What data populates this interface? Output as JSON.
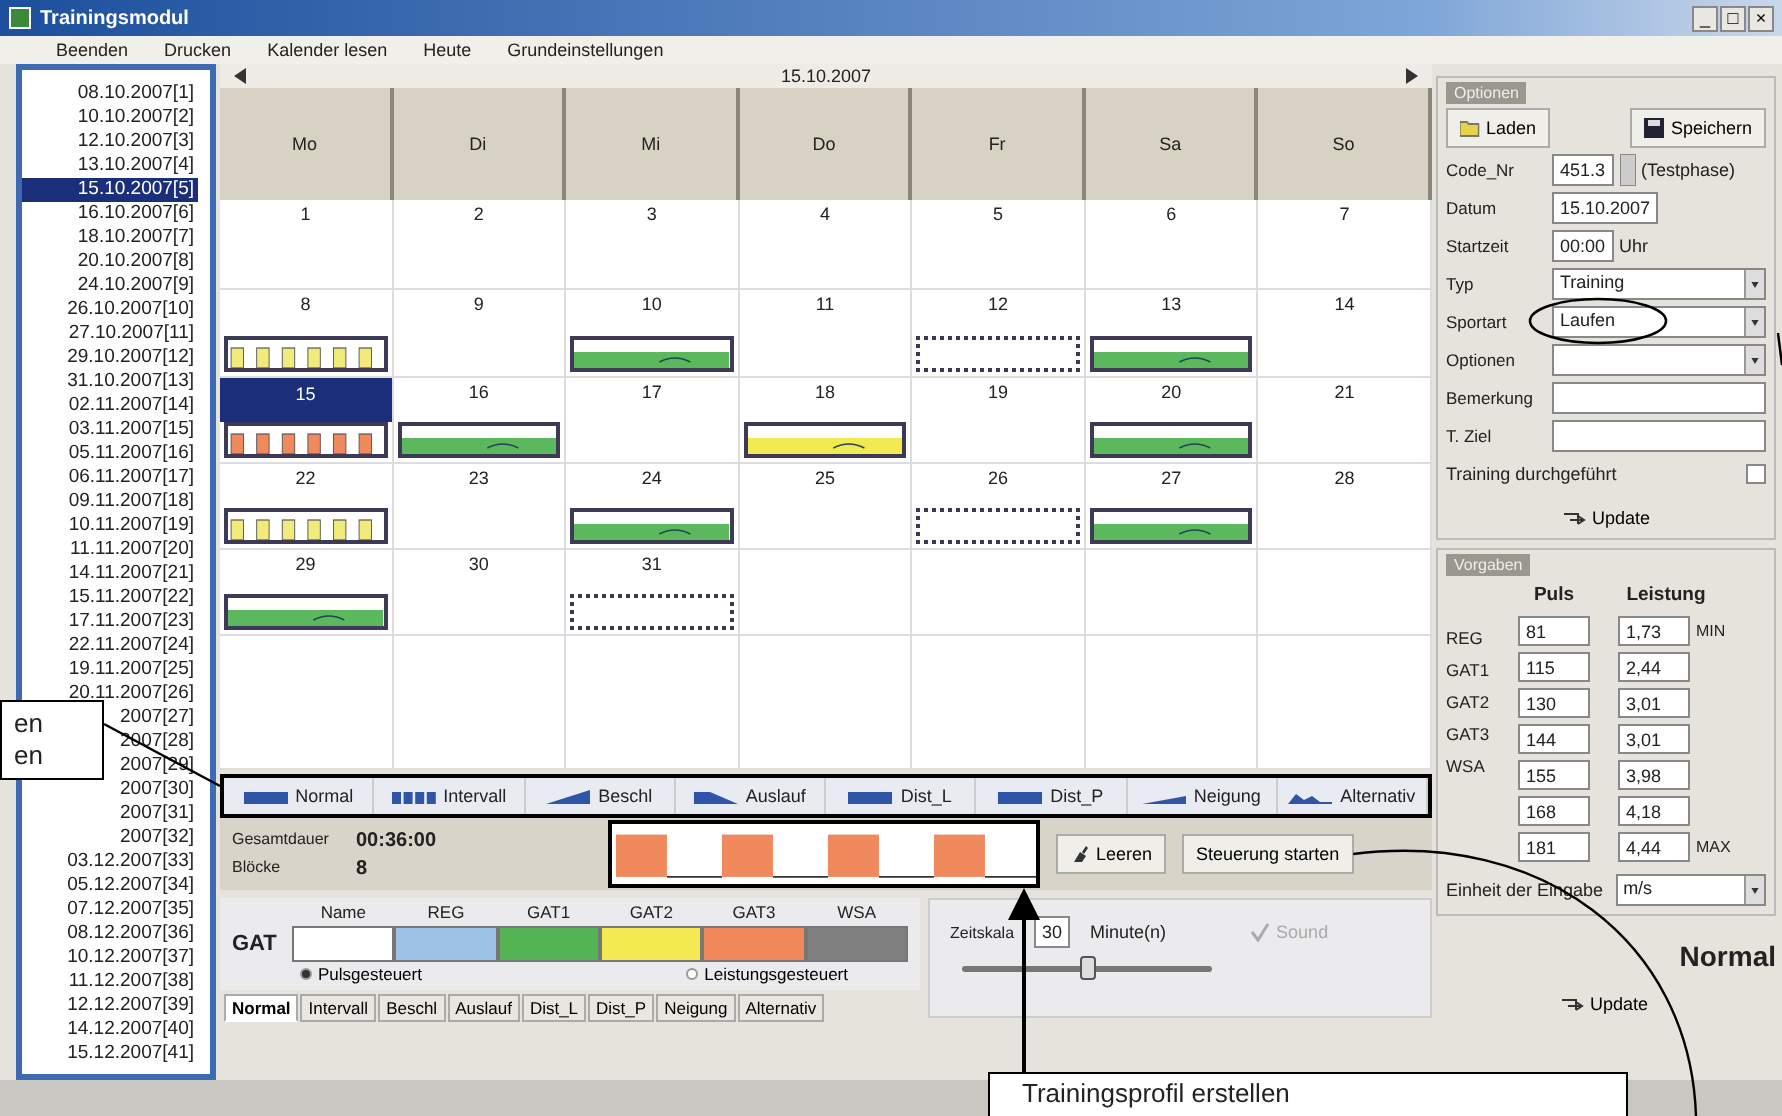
{
  "window": {
    "title": "Trainingsmodul",
    "controls": [
      "_",
      "□",
      "×"
    ]
  },
  "menu": [
    "Beenden",
    "Drucken",
    "Kalender lesen",
    "Heute",
    "Grundeinstellungen"
  ],
  "date_list": [
    {
      "label": "08.10.2007[1]",
      "selected": false
    },
    {
      "label": "10.10.2007[2]",
      "selected": false
    },
    {
      "label": "12.10.2007[3]",
      "selected": false
    },
    {
      "label": "13.10.2007[4]",
      "selected": false
    },
    {
      "label": "15.10.2007[5]",
      "selected": true
    },
    {
      "label": "16.10.2007[6]",
      "selected": false
    },
    {
      "label": "18.10.2007[7]",
      "selected": false
    },
    {
      "label": "20.10.2007[8]",
      "selected": false
    },
    {
      "label": "24.10.2007[9]",
      "selected": false
    },
    {
      "label": "26.10.2007[10]",
      "selected": false
    },
    {
      "label": "27.10.2007[11]",
      "selected": false
    },
    {
      "label": "29.10.2007[12]",
      "selected": false
    },
    {
      "label": "31.10.2007[13]",
      "selected": false
    },
    {
      "label": "02.11.2007[14]",
      "selected": false
    },
    {
      "label": "03.11.2007[15]",
      "selected": false
    },
    {
      "label": "05.11.2007[16]",
      "selected": false
    },
    {
      "label": "06.11.2007[17]",
      "selected": false
    },
    {
      "label": "09.11.2007[18]",
      "selected": false
    },
    {
      "label": "10.11.2007[19]",
      "selected": false
    },
    {
      "label": "11.11.2007[20]",
      "selected": false
    },
    {
      "label": "14.11.2007[21]",
      "selected": false
    },
    {
      "label": "15.11.2007[22]",
      "selected": false
    },
    {
      "label": "17.11.2007[23]",
      "selected": false
    },
    {
      "label": "22.11.2007[24]",
      "selected": false
    },
    {
      "label": "19.11.2007[25]",
      "selected": false
    },
    {
      "label": "20.11.2007[26]",
      "selected": false
    },
    {
      "label": "2007[27]",
      "selected": false
    },
    {
      "label": "2007[28]",
      "selected": false
    },
    {
      "label": "2007[29]",
      "selected": false
    },
    {
      "label": "2007[30]",
      "selected": false
    },
    {
      "label": "2007[31]",
      "selected": false
    },
    {
      "label": "2007[32]",
      "selected": false
    },
    {
      "label": "03.12.2007[33]",
      "selected": false
    },
    {
      "label": "05.12.2007[34]",
      "selected": false
    },
    {
      "label": "07.12.2007[35]",
      "selected": false
    },
    {
      "label": "08.12.2007[36]",
      "selected": false
    },
    {
      "label": "10.12.2007[37]",
      "selected": false
    },
    {
      "label": "11.12.2007[38]",
      "selected": false
    },
    {
      "label": "12.12.2007[39]",
      "selected": false
    },
    {
      "label": "14.12.2007[40]",
      "selected": false
    },
    {
      "label": "15.12.2007[41]",
      "selected": false
    }
  ],
  "calendar": {
    "title": "15.10.2007",
    "weekdays": [
      "Mo",
      "Di",
      "Mi",
      "Do",
      "Fr",
      "Sa",
      "So"
    ],
    "weeks": [
      [
        {
          "day": "1",
          "selected": false
        },
        {
          "day": "2",
          "selected": false
        },
        {
          "day": "3",
          "selected": false
        },
        {
          "day": "4",
          "selected": false
        },
        {
          "day": "5",
          "selected": false
        },
        {
          "day": "6",
          "selected": false
        },
        {
          "day": "7",
          "selected": false
        }
      ],
      [
        {
          "day": "8",
          "selected": false,
          "workout": {
            "kind": "interval",
            "color": "#f2ea7a"
          }
        },
        {
          "day": "9",
          "selected": false
        },
        {
          "day": "10",
          "selected": false,
          "workout": {
            "kind": "normal",
            "color": "#5cb85c"
          }
        },
        {
          "day": "11",
          "selected": false
        },
        {
          "day": "12",
          "selected": false,
          "workout": {
            "kind": "empty"
          }
        },
        {
          "day": "13",
          "selected": false,
          "workout": {
            "kind": "normal",
            "color": "#5cb85c"
          }
        },
        {
          "day": "14",
          "selected": false
        }
      ],
      [
        {
          "day": "15",
          "selected": true,
          "workout": {
            "kind": "interval",
            "color": "#f08a5d"
          }
        },
        {
          "day": "16",
          "selected": false,
          "workout": {
            "kind": "normal",
            "color": "#5cb85c"
          }
        },
        {
          "day": "17",
          "selected": false
        },
        {
          "day": "18",
          "selected": false,
          "workout": {
            "kind": "normal",
            "color": "#f2ea50"
          }
        },
        {
          "day": "19",
          "selected": false
        },
        {
          "day": "20",
          "selected": false,
          "workout": {
            "kind": "normal",
            "color": "#5cb85c"
          }
        },
        {
          "day": "21",
          "selected": false
        }
      ],
      [
        {
          "day": "22",
          "selected": false,
          "workout": {
            "kind": "interval",
            "color": "#f2ea7a"
          }
        },
        {
          "day": "23",
          "selected": false
        },
        {
          "day": "24",
          "selected": false,
          "workout": {
            "kind": "normal",
            "color": "#5cb85c"
          }
        },
        {
          "day": "25",
          "selected": false
        },
        {
          "day": "26",
          "selected": false,
          "workout": {
            "kind": "empty"
          }
        },
        {
          "day": "27",
          "selected": false,
          "workout": {
            "kind": "normal",
            "color": "#5cb85c"
          }
        },
        {
          "day": "28",
          "selected": false
        }
      ],
      [
        {
          "day": "29",
          "selected": false,
          "workout": {
            "kind": "normal",
            "color": "#5cb85c"
          }
        },
        {
          "day": "30",
          "selected": false
        },
        {
          "day": "31",
          "selected": false,
          "workout": {
            "kind": "empty"
          }
        }
      ]
    ]
  },
  "legend": [
    {
      "kind": "normal",
      "label": "Normal"
    },
    {
      "kind": "interval",
      "label": "Intervall"
    },
    {
      "kind": "ramp_up",
      "label": "Beschl"
    },
    {
      "kind": "ramp_down",
      "label": "Auslauf"
    },
    {
      "kind": "bar",
      "label": "Dist_L"
    },
    {
      "kind": "bar",
      "label": "Dist_P"
    },
    {
      "kind": "slope",
      "label": "Neigung"
    },
    {
      "kind": "wave",
      "label": "Alternativ"
    }
  ],
  "summary": {
    "duration_label": "Gesamtdauer",
    "duration": "00:36:00",
    "blocks_label": "Blöcke",
    "blocks": "8"
  },
  "buttons": [
    "Leeren",
    "Steuerung starten"
  ],
  "zones": {
    "label": "GAT",
    "items": [
      {
        "name": "Name",
        "color": "#ffffff"
      },
      {
        "name": "REG",
        "color": "#9cc3e6"
      },
      {
        "name": "GAT1",
        "color": "#55b555"
      },
      {
        "name": "GAT2",
        "color": "#f2ea50"
      },
      {
        "name": "GAT3",
        "color": "#f08a5d"
      },
      {
        "name": "WSA",
        "color": "#808080"
      }
    ]
  },
  "control_mode": [
    {
      "label": "Pulsgesteuert",
      "selected": true
    },
    {
      "label": "Leistungsgesteuert",
      "selected": false
    }
  ],
  "tabs": [
    {
      "label": "Normal",
      "selected": true
    },
    {
      "label": "Intervall",
      "selected": false
    },
    {
      "label": "Beschl",
      "selected": false
    },
    {
      "label": "Auslauf",
      "selected": false
    },
    {
      "label": "Dist_L",
      "selected": false
    },
    {
      "label": "Dist_P",
      "selected": false
    },
    {
      "label": "Neigung",
      "selected": false
    },
    {
      "label": "Alternativ",
      "selected": false
    }
  ],
  "timescale": {
    "label": "Zeitskala",
    "value": "30",
    "unit": "Minute(n)",
    "level": 0.5
  },
  "sound": {
    "label": "Sound",
    "checked": true,
    "disabled": true
  },
  "options": {
    "title": "Optionen",
    "load": "Laden",
    "save": "Speichern",
    "code_label": "Code_Nr",
    "code": "451.3",
    "code_note": "(Testphase)",
    "date_label": "Datum",
    "date": "15.10.2007",
    "start_label": "Startzeit",
    "start": "00:00",
    "start_unit": "Uhr",
    "type_label": "Typ",
    "type": "Training",
    "sport_label": "Sportart",
    "sport": "Laufen",
    "options_label": "Optionen",
    "note_label": "Bemerkung",
    "goal_label": "T. Ziel",
    "done_label": "Training durchgeführt",
    "done": false,
    "update": "Update"
  },
  "targets": {
    "title": "Vorgaben",
    "pulse_label": "Puls",
    "power_label": "Leistung",
    "zone_labels": [
      "REG",
      "GAT1",
      "GAT2",
      "GAT3",
      "WSA"
    ],
    "rows": [
      {
        "pulse": "81",
        "power": "1,73",
        "note": "MIN"
      },
      {
        "pulse": "115",
        "power": "2,44"
      },
      {
        "pulse": "130",
        "power": "3,01"
      },
      {
        "pulse": "144",
        "power": "3,01"
      },
      {
        "pulse": "155",
        "power": "3,98"
      },
      {
        "pulse": "168",
        "power": "4,18"
      },
      {
        "pulse": "181",
        "power": "4,44",
        "note": "MAX"
      }
    ],
    "unit_label": "Einheit der Eingabe",
    "unit": "m/s"
  },
  "mode_label": "Normal",
  "update": "Update",
  "annotations": {
    "left": [
      "en",
      "en"
    ],
    "bottom": "Trainingsprofil erstellen"
  }
}
